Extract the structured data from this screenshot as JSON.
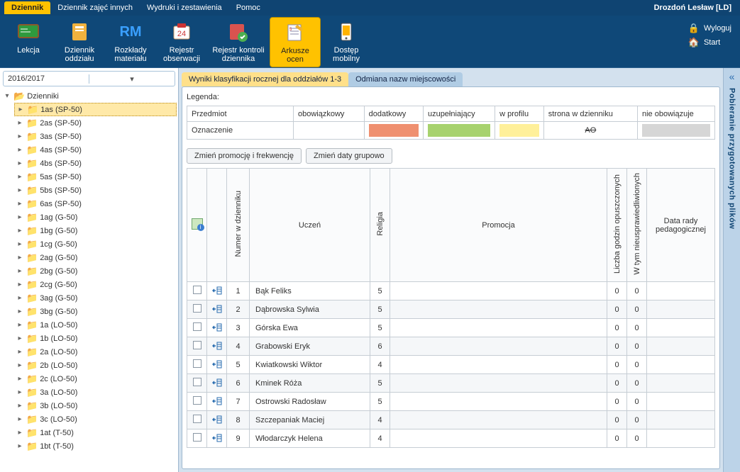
{
  "user": "Drozdoń Lesław [LD]",
  "menu_tabs": [
    "Dziennik",
    "Dziennik zajęć innych",
    "Wydruki i zestawienia",
    "Pomoc"
  ],
  "menu_active": 0,
  "ribbon": [
    {
      "label": "Lekcja",
      "icon": "board"
    },
    {
      "label": "Dziennik oddziału",
      "icon": "journal"
    },
    {
      "label": "Rozkłady materiału",
      "icon": "rm"
    },
    {
      "label": "Rejestr obserwacji",
      "icon": "register"
    },
    {
      "label": "Rejestr kontroli dziennika",
      "icon": "control"
    },
    {
      "label": "Arkusze ocen",
      "icon": "sheet"
    },
    {
      "label": "Dostęp mobilny",
      "icon": "mobile"
    }
  ],
  "ribbon_active": 5,
  "top_right": {
    "logout": "Wyloguj",
    "start": "Start"
  },
  "year": "2016/2017",
  "tree_root": "Dzienniki",
  "tree_items": [
    "1as (SP-50)",
    "2as (SP-50)",
    "3as (SP-50)",
    "4as (SP-50)",
    "4bs (SP-50)",
    "5as (SP-50)",
    "5bs (SP-50)",
    "6as (SP-50)",
    "1ag (G-50)",
    "1bg (G-50)",
    "1cg (G-50)",
    "2ag (G-50)",
    "2bg (G-50)",
    "2cg (G-50)",
    "3ag (G-50)",
    "3bg (G-50)",
    "1a (LO-50)",
    "1b (LO-50)",
    "2a (LO-50)",
    "2b (LO-50)",
    "2c (LO-50)",
    "3a (LO-50)",
    "3b (LO-50)",
    "3c (LO-50)",
    "1at (T-50)",
    "1bt (T-50)"
  ],
  "tree_selected": 0,
  "content_tabs": [
    "Wyniki klasyfikacji rocznej dla oddziałów 1-3",
    "Odmiana nazw miejscowości"
  ],
  "content_tab_active": 0,
  "legend": {
    "title": "Legenda:",
    "row1_label": "Przedmiot",
    "row2_label": "Oznaczenie",
    "cols": [
      "obowiązkowy",
      "dodatkowy",
      "uzupełniający",
      "w profilu",
      "strona w dzienniku",
      "nie obowiązuje"
    ],
    "swatches": [
      "#ffffff",
      "#ef9070",
      "#a7d26e",
      "#fff09a",
      "AO",
      "#d6d6d6"
    ]
  },
  "buttons": {
    "b1": "Zmień promocję i frekwencję",
    "b2": "Zmień daty grupowo"
  },
  "grid": {
    "headers": {
      "col_numer": "Numer w dzienniku",
      "col_uczen": "Uczeń",
      "col_religia": "Religia",
      "col_promocja": "Promocja",
      "col_opuszcz": "Liczba godzin opuszczonych",
      "col_nieuspr": "W tym nieusprawiedliwionych",
      "col_data": "Data rady pedagogicznej"
    },
    "rows": [
      {
        "n": 1,
        "name": "Bąk Feliks",
        "rel": 5,
        "prom": "",
        "op": 0,
        "ni": 0,
        "dr": ""
      },
      {
        "n": 2,
        "name": "Dąbrowska Sylwia",
        "rel": 5,
        "prom": "",
        "op": 0,
        "ni": 0,
        "dr": ""
      },
      {
        "n": 3,
        "name": "Górska Ewa",
        "rel": 5,
        "prom": "",
        "op": 0,
        "ni": 0,
        "dr": ""
      },
      {
        "n": 4,
        "name": "Grabowski Eryk",
        "rel": 6,
        "prom": "",
        "op": 0,
        "ni": 0,
        "dr": ""
      },
      {
        "n": 5,
        "name": "Kwiatkowski Wiktor",
        "rel": 4,
        "prom": "",
        "op": 0,
        "ni": 0,
        "dr": ""
      },
      {
        "n": 6,
        "name": "Kminek Róża",
        "rel": 5,
        "prom": "",
        "op": 0,
        "ni": 0,
        "dr": ""
      },
      {
        "n": 7,
        "name": "Ostrowski Radosław",
        "rel": 5,
        "prom": "",
        "op": 0,
        "ni": 0,
        "dr": ""
      },
      {
        "n": 8,
        "name": "Szczepaniak Maciej",
        "rel": 4,
        "prom": "",
        "op": 0,
        "ni": 0,
        "dr": ""
      },
      {
        "n": 9,
        "name": "Włodarczyk Helena",
        "rel": 4,
        "prom": "",
        "op": 0,
        "ni": 0,
        "dr": ""
      }
    ]
  },
  "right_rail": "Pobieranie przygotowanych plików"
}
